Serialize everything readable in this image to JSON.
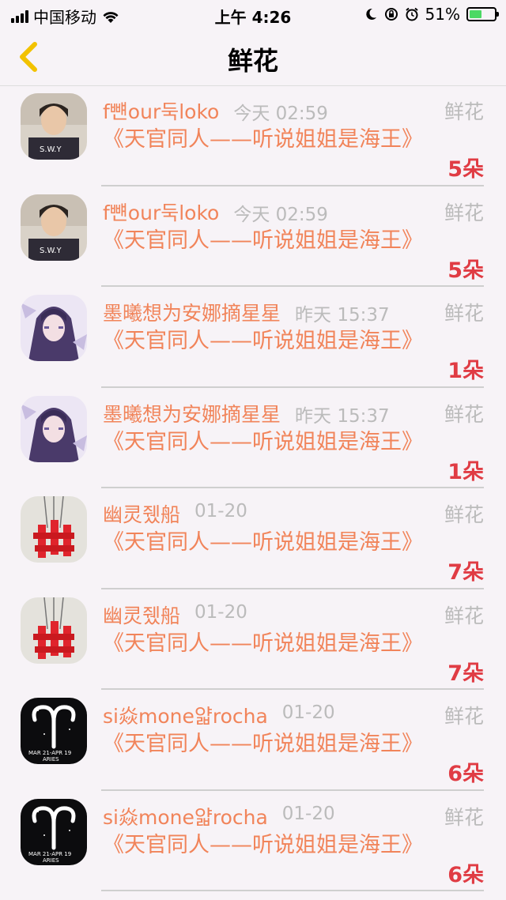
{
  "status_bar": {
    "carrier": "中国移动",
    "time": "上午 4:26",
    "battery": "51%",
    "battery_level": 0.51
  },
  "nav": {
    "title": "鲜花",
    "back_icon": "chevron-left-icon"
  },
  "colors": {
    "accent": "#f1845a",
    "count": "#e03c44",
    "meta": "#bbbbbb",
    "back": "#f2c200"
  },
  "items": [
    {
      "name": "f뺸our둑loko",
      "time": "今天 02:59",
      "type": "鲜花",
      "title": "《天官同人——听说姐姐是海王》",
      "count": "5朵",
      "avatar": "photo"
    },
    {
      "name": "f뺸our둑loko",
      "time": "今天 02:59",
      "type": "鲜花",
      "title": "《天官同人——听说姐姐是海王》",
      "count": "5朵",
      "avatar": "photo"
    },
    {
      "name": "墨曦想为安娜摘星星",
      "time": "昨天 15:37",
      "type": "鲜花",
      "title": "《天官同人——听说姐姐是海王》",
      "count": "1朵",
      "avatar": "anime"
    },
    {
      "name": "墨曦想为安娜摘星星",
      "time": "昨天 15:37",
      "type": "鲜花",
      "title": "《天官同人——听说姐姐是海王》",
      "count": "1朵",
      "avatar": "anime"
    },
    {
      "name": "幽灵쥈船",
      "time": "01-20",
      "type": "鲜花",
      "title": "《天官同人——听说姐姐是海王》",
      "count": "7朵",
      "avatar": "red"
    },
    {
      "name": "幽灵쥈船",
      "time": "01-20",
      "type": "鲜花",
      "title": "《天官同人——听说姐姐是海王》",
      "count": "7朵",
      "avatar": "red"
    },
    {
      "name": "si焱mone얇rocha",
      "time": "01-20",
      "type": "鲜花",
      "title": "《天官同人——听说姐姐是海王》",
      "count": "6朵",
      "avatar": "aries"
    },
    {
      "name": "si焱mone얇rocha",
      "time": "01-20",
      "type": "鲜花",
      "title": "《天官同人——听说姐姐是海王》",
      "count": "6朵",
      "avatar": "aries"
    }
  ]
}
